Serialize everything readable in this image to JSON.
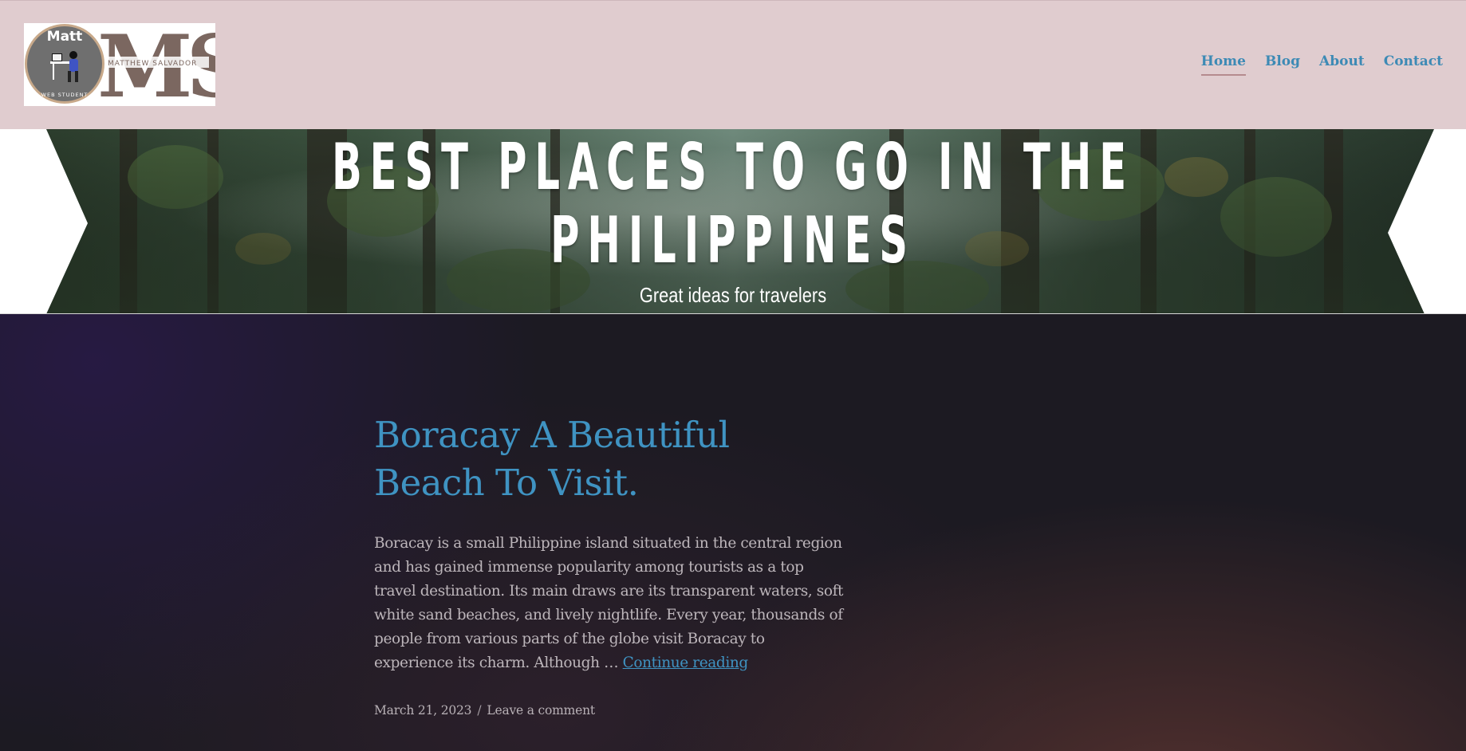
{
  "site": {
    "logo": {
      "badge_name": "Matt",
      "badge_caption": "WEB STUDENT",
      "monogram": "MS",
      "full_name": "MATTHEW SALVADOR"
    },
    "nav": [
      {
        "label": "Home",
        "active": true
      },
      {
        "label": "Blog",
        "active": false
      },
      {
        "label": "About",
        "active": false
      },
      {
        "label": "Contact",
        "active": false
      }
    ]
  },
  "hero": {
    "title_line1": "BEST PLACES TO GO IN THE",
    "title_line2": "PHILIPPINES",
    "subtitle": "Great ideas for travelers"
  },
  "post": {
    "title": "Boracay A Beautiful Beach To Visit.",
    "excerpt": "Boracay is a small Philippine island situated in the central region and has gained immense popularity among tourists as a top travel destination. Its main draws are its transparent waters, soft white sand beaches, and lively nightlife. Every year, thousands of people from various parts of the globe visit Boracay to experience its charm. Although …",
    "continue_label": "Continue reading",
    "date": "March 21, 2023",
    "separator": "/",
    "comment_label": "Leave a comment"
  },
  "colors": {
    "header_bg": "#e0cccf",
    "link": "#3f93c2",
    "nav_underline": "#b58b8f",
    "body_text": "#bdb6bb",
    "content_bg": "#1c1a22"
  }
}
